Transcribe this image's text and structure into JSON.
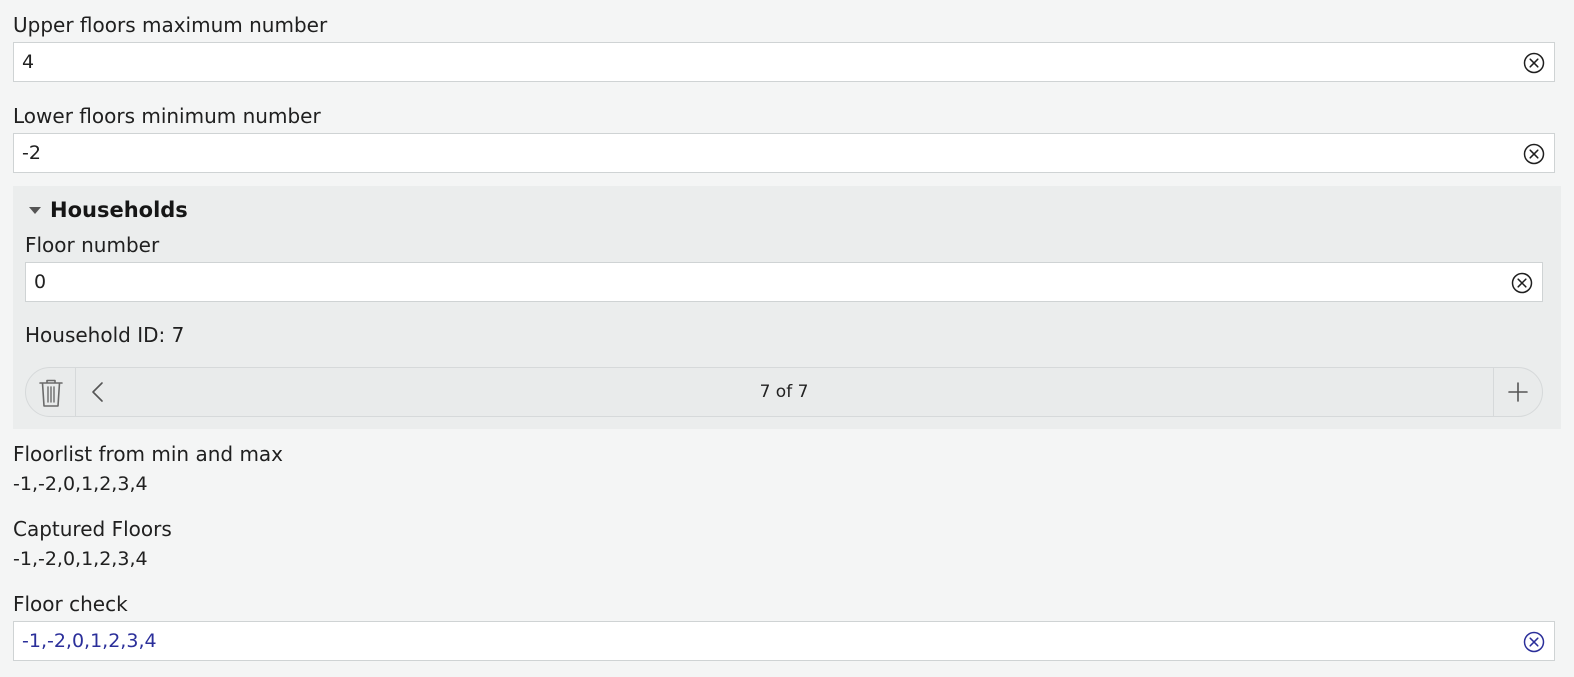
{
  "fields": {
    "upper_floors": {
      "label": "Upper floors maximum number",
      "value": "4"
    },
    "lower_floors": {
      "label": "Lower floors minimum number",
      "value": "-2"
    }
  },
  "households": {
    "title": "Households",
    "floor_number": {
      "label": "Floor number",
      "value": "0"
    },
    "household_id": "Household ID: 7",
    "pager": {
      "current": 7,
      "total": 7,
      "text": "7 of 7"
    }
  },
  "floorlist": {
    "label": "Floorlist from min and max",
    "value": "-1,-2,0,1,2,3,4"
  },
  "captured_floors": {
    "label": "Captured Floors",
    "value": "-1,-2,0,1,2,3,4"
  },
  "floor_check": {
    "label": "Floor check",
    "value": "-1,-2,0,1,2,3,4"
  },
  "colors": {
    "background": "#f4f5f5",
    "group_background": "#ebeded",
    "floor_check_text": "#2b2f9a",
    "floor_check_clear_icon": "#2b2f9a"
  },
  "icons": {
    "clear": "circle-x-icon",
    "collapse": "caret-down-icon",
    "delete": "trash-icon",
    "previous": "chevron-left-icon",
    "add": "plus-icon"
  }
}
